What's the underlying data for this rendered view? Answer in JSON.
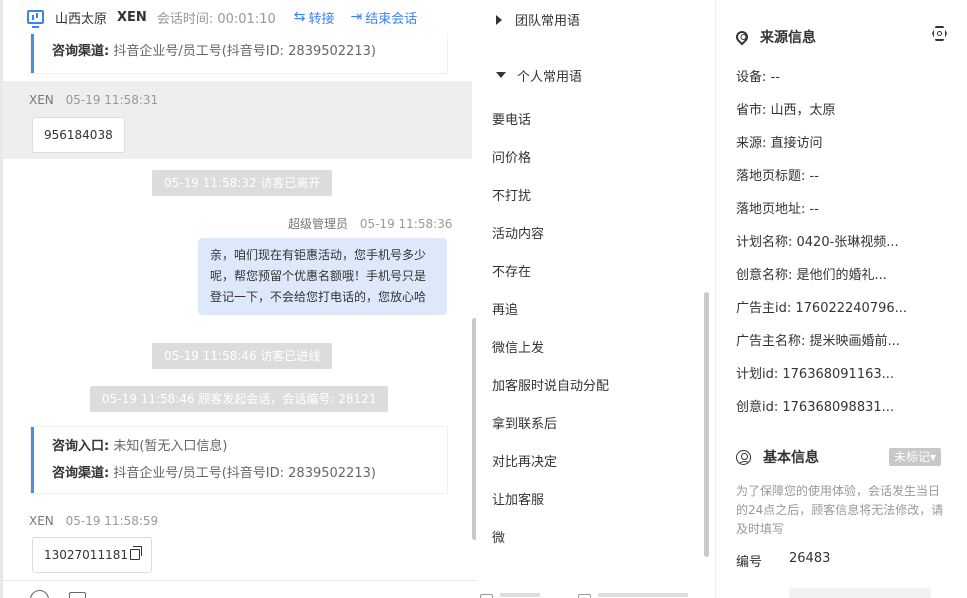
{
  "header": {
    "location": "山西太原",
    "visitor": "XEN",
    "session_time_label": "会话时间:",
    "session_time": "00:01:10",
    "transfer": "转接",
    "end_session": "结束会话"
  },
  "chat": {
    "card_top": {
      "channel_label": "咨询渠道:",
      "channel_value": "抖音企业号/员工号(抖音号ID: 2839502213)"
    },
    "msg1": {
      "who": "XEN",
      "time": "05-19 11:58:31",
      "text": "956184038"
    },
    "sys1": "05-19 11:58:32 访客已离开",
    "msg2": {
      "who": "超级管理员",
      "time": "05-19 11:58:36",
      "text": "亲，咱们现在有钜惠活动，您手机号多少呢，帮您预留个优惠名额哦！手机号只是登记一下，不会给您打电话的，您放心哈"
    },
    "sys2": "05-19 11:58:46 访客已进线",
    "sys3": "05-19 11:58:46 顾客发起会话，会话编号: 28121",
    "card_bottom": {
      "entry_label": "咨询入口:",
      "entry_value": "未知(暂无入口信息)",
      "channel_label": "咨询渠道:",
      "channel_value": "抖音企业号/员工号(抖音号ID: 2839502213)"
    },
    "msg3": {
      "who": "XEN",
      "time": "05-19 11:58:59",
      "text": "13027011181"
    }
  },
  "phrases": {
    "group_team": "团队常用语",
    "group_personal": "个人常用语",
    "items": [
      "要电话",
      "问价格",
      "不打扰",
      "活动内容",
      "不存在",
      "再追",
      "微信上发",
      "加客服时说自动分配",
      "拿到联系后",
      "对比再决定",
      "让加客服",
      "微"
    ]
  },
  "info": {
    "source_title": "来源信息",
    "rows": [
      {
        "text": "设备: --"
      },
      {
        "text": "省市: 山西，太原"
      },
      {
        "text": "来源: 直接访问"
      },
      {
        "text": "落地页标题: --"
      },
      {
        "text": "落地页地址: --"
      },
      {
        "text": "计划名称: 0420-张琳视频..."
      },
      {
        "text": "创意名称: 是他们的婚礼..."
      },
      {
        "text": "广告主id: 176022240796..."
      },
      {
        "text": "广告主名称: 提米映画婚前..."
      },
      {
        "text": "计划id: 176368091163..."
      },
      {
        "text": "创意id: 176368098831..."
      }
    ],
    "basic_title": "基本信息",
    "tag": "未标记▾",
    "note": "为了保障您的使用体验，会话发生当日的24点之后，顾客信息将无法修改，请及时填写",
    "id_label": "编号",
    "id_value": "26483"
  }
}
